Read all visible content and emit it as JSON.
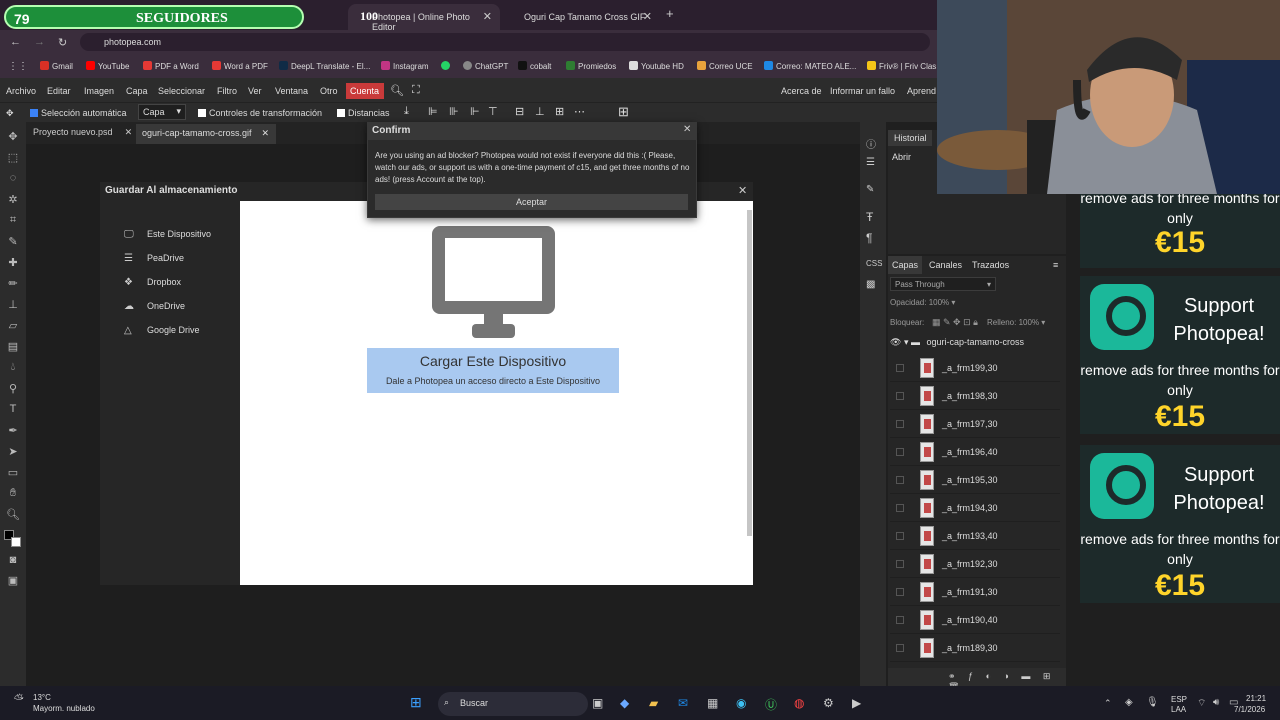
{
  "overlay": {
    "counter": "79",
    "label": "SEGUIDORES",
    "count": "100"
  },
  "browser": {
    "tabs": [
      {
        "title": "Photopea | Online Photo Editor"
      },
      {
        "title": "Oguri Cap Tamamo Cross GIF"
      }
    ],
    "url": "photopea.com",
    "bookmarks": [
      "Gmail",
      "YouTube",
      "PDF a Word",
      "Word a PDF",
      "DeepL Translate - El...",
      "Instagram",
      "ChatGPT",
      "cobalt",
      "Promiedos",
      "Youtube HD",
      "Correo UCE",
      "Correo: MATEO ALE...",
      "Friv® | Friv Clas"
    ]
  },
  "menu": {
    "items": [
      "Archivo",
      "Editar",
      "Imagen",
      "Capa",
      "Seleccionar",
      "Filtro",
      "Ver",
      "Ventana",
      "Otro"
    ],
    "account": "Cuenta",
    "right": [
      "Acerca de",
      "Informar un fallo",
      "Aprend"
    ]
  },
  "options": {
    "auto_select": "Selección automática",
    "layer_select": "Capa",
    "transform": "Controles de transformación",
    "distances": "Distancias"
  },
  "doc_tabs": [
    "Proyecto nuevo.psd",
    "oguri-cap-tamamo-cross.gif"
  ],
  "save_dialog": {
    "title": "Guardar Al almacenamiento",
    "locations": [
      "Este Dispositivo",
      "PeaDrive",
      "Dropbox",
      "OneDrive",
      "Google Drive"
    ],
    "load_title": "Cargar Este Dispositivo",
    "load_sub": "Dale a Photopea un acceso directo a Este Dispositivo"
  },
  "confirm": {
    "title": "Confirm",
    "message": "Are you using an ad blocker? Photopea would not exist if everyone did this :( Please, watch our ads, or support us with a one-time payment of c15, and get three months of no ads! (press Account at the top).",
    "button": "Aceptar"
  },
  "history": {
    "tab": "Historial",
    "items": [
      "Abrir"
    ]
  },
  "layers": {
    "tabs": [
      "Capas",
      "Canales",
      "Trazados"
    ],
    "blend": "Pass Through",
    "opacity_label": "Opacidad:",
    "opacity": "100%",
    "lock_label": "Bloquear:",
    "fill_label": "Relleno:",
    "fill": "100%",
    "folder": "oguri-cap-tamamo-cross",
    "rows": [
      "_a_frm199,30",
      "_a_frm198,30",
      "_a_frm197,30",
      "_a_frm196,40",
      "_a_frm195,30",
      "_a_frm194,30",
      "_a_frm193,40",
      "_a_frm192,30",
      "_a_frm191,30",
      "_a_frm190,40",
      "_a_frm189,30"
    ]
  },
  "ads": {
    "top_text": "remove ads for three months for only",
    "top_price": "€15",
    "title": "Support Photopea!",
    "text": "remove ads for three months for only",
    "price": "€15"
  },
  "taskbar": {
    "weather_temp": "13°C",
    "weather_desc": "Mayorm. nublado",
    "search": "Buscar",
    "lang": "ESP",
    "lang2": "LAA",
    "time": "21:21",
    "date": "7/1/2026"
  }
}
